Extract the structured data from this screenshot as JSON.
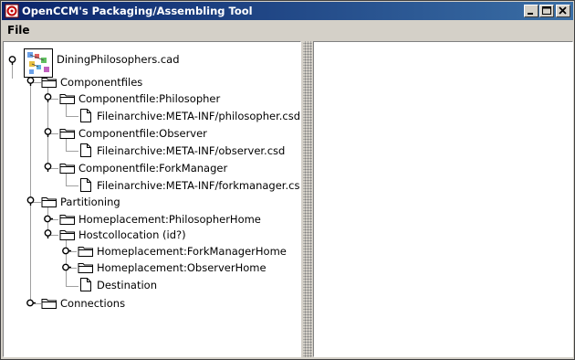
{
  "window": {
    "title": "OpenCCM's Packaging/Assembling Tool",
    "controls": [
      "minimize",
      "maximize",
      "close"
    ]
  },
  "menu": {
    "file": "File"
  },
  "tree": {
    "root": "DiningPhilosophers.cad",
    "componentfiles": {
      "label": "Componentfiles",
      "items": [
        {
          "label": "Componentfile:Philosopher",
          "child": "Fileinarchive:META-INF/philosopher.csd"
        },
        {
          "label": "Componentfile:Observer",
          "child": "Fileinarchive:META-INF/observer.csd"
        },
        {
          "label": "Componentfile:ForkManager",
          "child": "Fileinarchive:META-INF/forkmanager.csd"
        }
      ]
    },
    "partitioning": {
      "label": "Partitioning",
      "homeplacement": "Homeplacement:PhilosopherHome",
      "hostcollocation": {
        "label": "Hostcollocation (id?)",
        "items": [
          "Homeplacement:ForkManagerHome",
          "Homeplacement:ObserverHome",
          "Destination"
        ]
      }
    },
    "connections": "Connections"
  },
  "icons": {
    "expanded": "expanded-handle-icon",
    "collapsed": "collapsed-handle-icon",
    "folder": "folder-icon",
    "file": "file-icon"
  }
}
